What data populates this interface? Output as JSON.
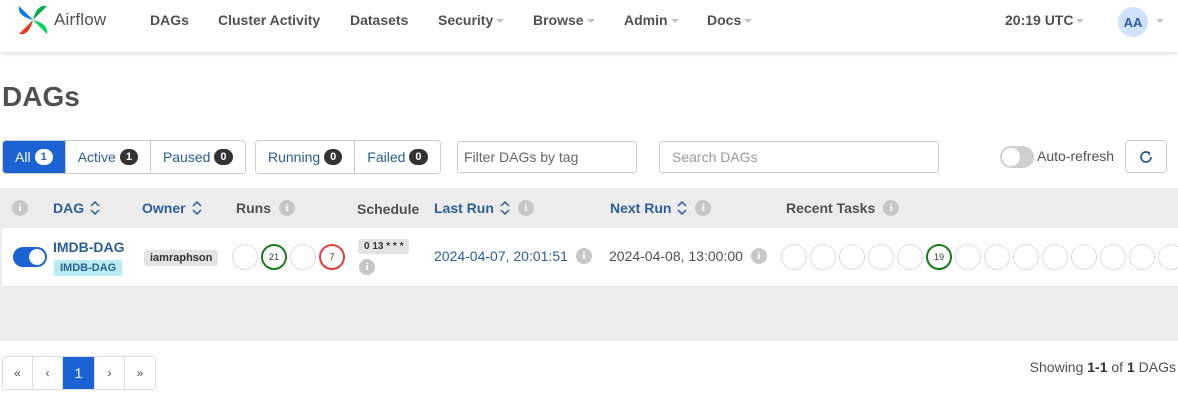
{
  "navbar": {
    "brand": "Airflow",
    "items": [
      {
        "label": "DAGs",
        "dropdown": false
      },
      {
        "label": "Cluster Activity",
        "dropdown": false
      },
      {
        "label": "Datasets",
        "dropdown": false
      },
      {
        "label": "Security",
        "dropdown": true
      },
      {
        "label": "Browse",
        "dropdown": true
      },
      {
        "label": "Admin",
        "dropdown": true
      },
      {
        "label": "Docs",
        "dropdown": true
      }
    ],
    "time": "20:19 UTC",
    "avatar": "AA"
  },
  "page_title": "DAGs",
  "filters": {
    "status": [
      {
        "label": "All",
        "count": "1",
        "active": true
      },
      {
        "label": "Active",
        "count": "1"
      },
      {
        "label": "Paused",
        "count": "0"
      }
    ],
    "runs": [
      {
        "label": "Running",
        "count": "0"
      },
      {
        "label": "Failed",
        "count": "0"
      }
    ],
    "tag_placeholder": "Filter DAGs by tag",
    "search_placeholder": "Search DAGs",
    "auto_refresh_label": "Auto-refresh"
  },
  "table": {
    "headers": {
      "dag": "DAG",
      "owner": "Owner",
      "runs": "Runs",
      "schedule": "Schedule",
      "last_run": "Last Run",
      "next_run": "Next Run",
      "recent_tasks": "Recent Tasks"
    },
    "rows": [
      {
        "enabled": true,
        "dag_id": "IMDB-DAG",
        "tag": "IMDB-DAG",
        "owner": "iamraphson",
        "runs": [
          {
            "state": "queued",
            "count": ""
          },
          {
            "state": "success",
            "count": "21"
          },
          {
            "state": "running",
            "count": ""
          },
          {
            "state": "failed",
            "count": "7"
          }
        ],
        "schedule": "0 13 * * *",
        "last_run": "2024-04-07, 20:01:51",
        "next_run": "2024-04-08, 13:00:00",
        "recent_tasks": [
          "",
          "",
          "",
          "",
          "",
          "19",
          "",
          "",
          "",
          "",
          "",
          "",
          "",
          ""
        ]
      }
    ]
  },
  "pagination": {
    "first": "«",
    "prev": "‹",
    "current": "1",
    "next": "›",
    "last": "»",
    "showing_prefix": "Showing ",
    "range": "1-1",
    "of": " of ",
    "total": "1",
    "suffix": " DAGs"
  },
  "colors": {
    "primary": "#1b63d5",
    "link": "#2a5f97",
    "success": "#1a7a1a",
    "failed": "#e53e3e",
    "tag_bg": "#b8ecf2"
  }
}
